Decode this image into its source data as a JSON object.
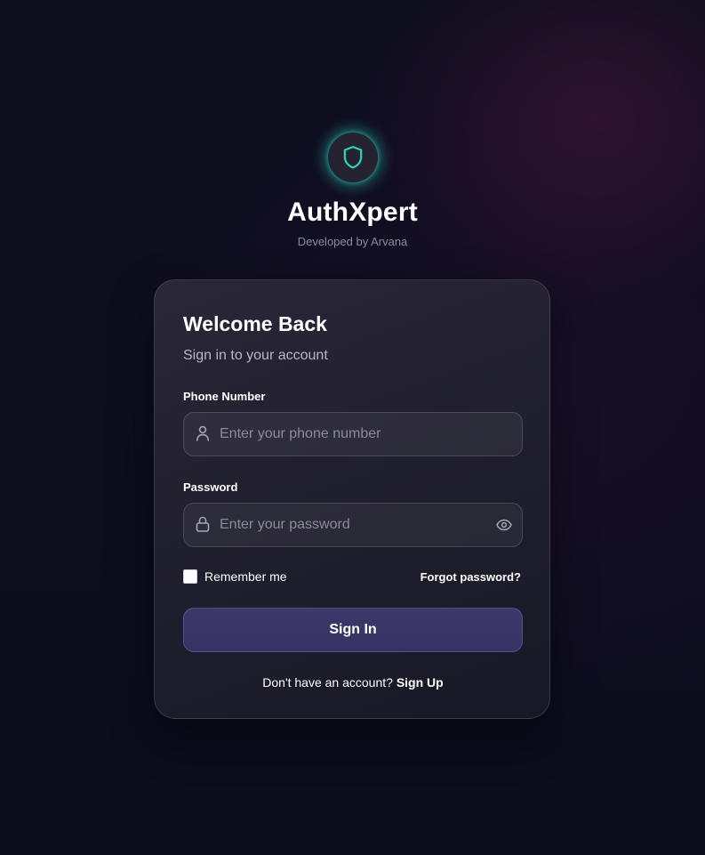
{
  "brand": {
    "title": "AuthXpert",
    "subtitle": "Developed by Arvana",
    "logo_icon": "shield-icon",
    "accent_color": "#2dd4bf"
  },
  "login_card": {
    "title": "Welcome Back",
    "subtitle": "Sign in to your account",
    "phone_field": {
      "label": "Phone Number",
      "placeholder": "Enter your phone number",
      "value": "",
      "icon": "user-icon"
    },
    "password_field": {
      "label": "Password",
      "placeholder": "Enter your password",
      "value": "",
      "icon": "lock-icon",
      "toggle_icon": "eye-icon"
    },
    "remember_me": {
      "label": "Remember me",
      "checked": false
    },
    "forgot_password_label": "Forgot password?",
    "sign_in_label": "Sign In",
    "signup_prompt": "Don't have an account?",
    "signup_link_label": "Sign Up",
    "button_color": "#38345f"
  }
}
